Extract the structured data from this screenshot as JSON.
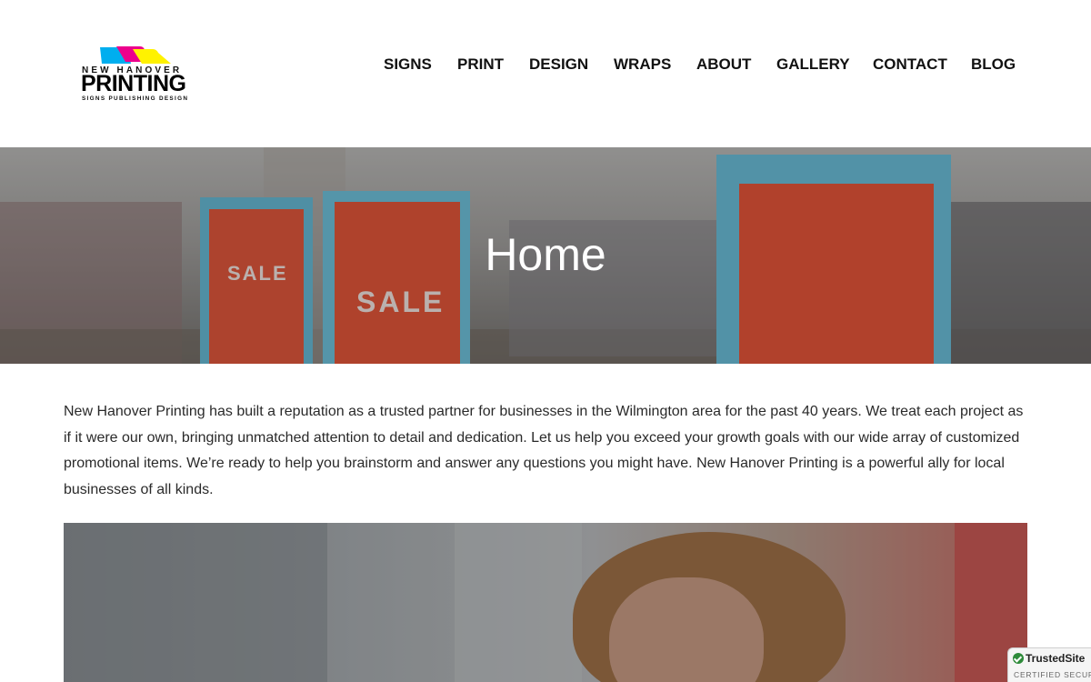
{
  "logo": {
    "line1": "NEW HANOVER",
    "line2": "PRINTING",
    "line3": "SIGNS   PUBLISHING   DESIGN",
    "colors": [
      "#00aeef",
      "#ec008c",
      "#fff200"
    ]
  },
  "nav": {
    "items": [
      {
        "label": "SIGNS"
      },
      {
        "label": "PRINT"
      },
      {
        "label": "DESIGN"
      },
      {
        "label": "WRAPS"
      },
      {
        "label": "ABOUT"
      },
      {
        "label": "GALLERY"
      },
      {
        "label": "CONTACT"
      },
      {
        "label": "BLOG"
      }
    ]
  },
  "hero": {
    "title": "Home",
    "sign_text": "SALE"
  },
  "intro": {
    "text": "New Hanover Printing has built a reputation as a trusted partner for businesses in the Wilmington area for the past 40 years. We treat each project as if it were our own, bringing unmatched attention to detail and dedication. Let us help you exceed your growth goals with our wide array of customized promotional items. We’re ready to help you brainstorm and answer any questions you might have. New Hanover Printing is a powerful ally for local businesses of all kinds."
  },
  "badge": {
    "title": "TrustedSite",
    "subtitle": "CERTIFIED SECURE",
    "icon": "checkmark-icon"
  }
}
